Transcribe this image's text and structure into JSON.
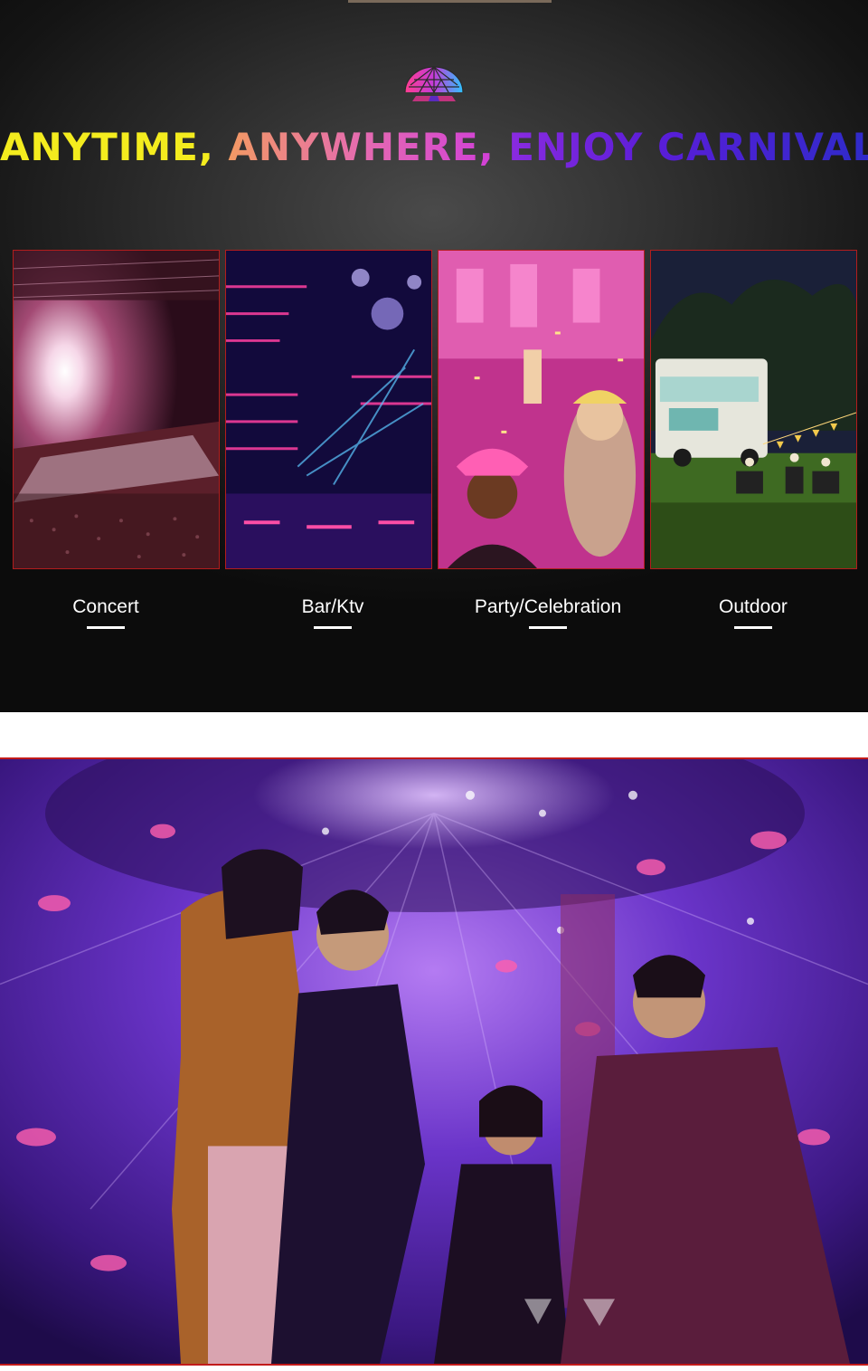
{
  "headline": {
    "part1": "ANYTIME,",
    "part2": "ANYWHERE,",
    "part3": "ENJOY CARNIVAL"
  },
  "scenes": [
    {
      "label": "Concert",
      "icon": "concert-photo"
    },
    {
      "label": "Bar/Ktv",
      "icon": "bar-photo"
    },
    {
      "label": "Party/Celebration",
      "icon": "party-photo"
    },
    {
      "label": "Outdoor",
      "icon": "outdoor-photo"
    }
  ],
  "colors": {
    "card_border": "#b21d1d",
    "headline_yellow": "#f4ec1e",
    "headline_pink": "#e56bb0",
    "headline_blue": "#2d2bc9",
    "photo_border": "#c21a1a"
  }
}
